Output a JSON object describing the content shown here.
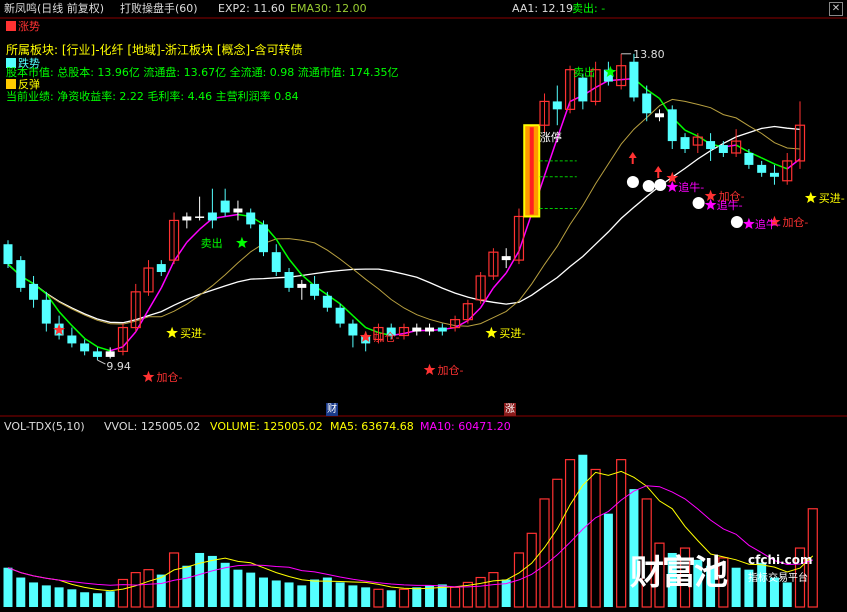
{
  "header": {
    "stock": "新凤鸣(日线 前复权)",
    "formula": "打败操盘手(60)",
    "exp2": "EXP2: 11.60",
    "ema30": "EMA30: 12.00",
    "aa1": "AA1: 12.19",
    "sell": "卖出: -",
    "close_icon": "close-icon"
  },
  "legend": {
    "zhangshi": "涨势",
    "ruoshi": "跌势",
    "fantan": "反弹"
  },
  "info": {
    "line1": "所属板块: [行业]-化纤 [地域]-浙江板块 [概念]-含可转债",
    "line2": "股本市值: 总股本: 13.96亿 流通盘: 13.67亿 全流通: 0.98 流通市值: 174.35亿",
    "line3": "当前业绩: 净资收益率: 2.22 毛利率: 4.46 主营利润率 0.84"
  },
  "annotations": {
    "high": "13.80",
    "low": "9.94",
    "zhangting": "涨停",
    "maichu_star": "卖出",
    "maichu_top": "卖出",
    "buy1": "买进-",
    "buy2": "买进-",
    "buy3": "买进-",
    "add1": "加仓-",
    "add2": "加仓-",
    "add3": "加仓-",
    "add4": "加仓-",
    "add5": "加仓-",
    "add6": "加仓-",
    "chase1": "追牛-",
    "chase2": "追牛-",
    "chase3": "追牛-"
  },
  "axis_marks": {
    "cai": "财",
    "zhang": "涨"
  },
  "volume_header": {
    "indicator": "VOL-TDX(5,10)",
    "vvol": "VVOL: 125005.02",
    "volume": "VOLUME: 125005.02",
    "ma5": "MA5: 63674.68",
    "ma10": "MA10: 60471.20"
  },
  "brand": {
    "name": "财富池",
    "url": "cfchi.com",
    "slogan": "指标交易平台"
  },
  "colors": {
    "up": "#ff3232",
    "down": "#54ffff",
    "yellow": "#ffff00",
    "green": "#00ff00",
    "magenta": "#ff00ff",
    "orange": "#ff9900"
  },
  "chart_data": {
    "type": "candlestick",
    "ylim": [
      9.5,
      14.1
    ],
    "candles": [
      {
        "o": 11.4,
        "c": 11.15,
        "h": 11.45,
        "l": 11.1,
        "c_": "down"
      },
      {
        "o": 11.2,
        "c": 10.85,
        "h": 11.25,
        "l": 10.8,
        "c_": "down"
      },
      {
        "o": 10.9,
        "c": 10.7,
        "h": 11.0,
        "l": 10.6,
        "c_": "down"
      },
      {
        "o": 10.7,
        "c": 10.4,
        "h": 10.8,
        "l": 10.3,
        "c_": "down"
      },
      {
        "o": 10.4,
        "c": 10.25,
        "h": 10.5,
        "l": 10.2,
        "c_": "down"
      },
      {
        "o": 10.25,
        "c": 10.15,
        "h": 10.35,
        "l": 10.1,
        "c_": "down"
      },
      {
        "o": 10.15,
        "c": 10.05,
        "h": 10.2,
        "l": 10.0,
        "c_": "down"
      },
      {
        "o": 10.05,
        "c": 9.98,
        "h": 10.1,
        "l": 9.94,
        "c_": "down"
      },
      {
        "o": 9.98,
        "c": 10.05,
        "h": 10.1,
        "l": 9.96,
        "c_": "flat"
      },
      {
        "o": 10.05,
        "c": 10.35,
        "h": 10.4,
        "l": 10.0,
        "c_": "up"
      },
      {
        "o": 10.35,
        "c": 10.8,
        "h": 10.9,
        "l": 10.3,
        "c_": "up"
      },
      {
        "o": 10.8,
        "c": 11.1,
        "h": 11.2,
        "l": 10.75,
        "c_": "up"
      },
      {
        "o": 11.05,
        "c": 11.15,
        "h": 11.2,
        "l": 11.0,
        "c_": "down"
      },
      {
        "o": 11.2,
        "c": 11.7,
        "h": 11.8,
        "l": 11.15,
        "c_": "up"
      },
      {
        "o": 11.7,
        "c": 11.75,
        "h": 11.8,
        "l": 11.6,
        "c_": "flat"
      },
      {
        "o": 11.75,
        "c": 11.75,
        "h": 12.0,
        "l": 11.7,
        "c_": "flat"
      },
      {
        "o": 11.8,
        "c": 11.7,
        "h": 12.1,
        "l": 11.6,
        "c_": "down"
      },
      {
        "o": 11.95,
        "c": 11.8,
        "h": 12.1,
        "l": 11.75,
        "c_": "down"
      },
      {
        "o": 11.8,
        "c": 11.85,
        "h": 11.95,
        "l": 11.7,
        "c_": "flat"
      },
      {
        "o": 11.8,
        "c": 11.65,
        "h": 11.85,
        "l": 11.6,
        "c_": "down"
      },
      {
        "o": 11.65,
        "c": 11.3,
        "h": 11.7,
        "l": 11.25,
        "c_": "down"
      },
      {
        "o": 11.3,
        "c": 11.05,
        "h": 11.4,
        "l": 11.0,
        "c_": "down"
      },
      {
        "o": 11.05,
        "c": 10.85,
        "h": 11.1,
        "l": 10.8,
        "c_": "down"
      },
      {
        "o": 10.9,
        "c": 10.85,
        "h": 10.95,
        "l": 10.7,
        "c_": "flat"
      },
      {
        "o": 10.9,
        "c": 10.75,
        "h": 11.0,
        "l": 10.7,
        "c_": "down"
      },
      {
        "o": 10.75,
        "c": 10.6,
        "h": 10.8,
        "l": 10.55,
        "c_": "down"
      },
      {
        "o": 10.6,
        "c": 10.4,
        "h": 10.65,
        "l": 10.35,
        "c_": "down"
      },
      {
        "o": 10.4,
        "c": 10.25,
        "h": 10.45,
        "l": 10.1,
        "c_": "down"
      },
      {
        "o": 10.25,
        "c": 10.15,
        "h": 10.3,
        "l": 10.05,
        "c_": "down"
      },
      {
        "o": 10.2,
        "c": 10.35,
        "h": 10.4,
        "l": 10.15,
        "c_": "up"
      },
      {
        "o": 10.35,
        "c": 10.25,
        "h": 10.4,
        "l": 10.2,
        "c_": "down"
      },
      {
        "o": 10.25,
        "c": 10.35,
        "h": 10.4,
        "l": 10.2,
        "c_": "up"
      },
      {
        "o": 10.35,
        "c": 10.3,
        "h": 10.4,
        "l": 10.25,
        "c_": "flat"
      },
      {
        "o": 10.3,
        "c": 10.35,
        "h": 10.4,
        "l": 10.25,
        "c_": "flat"
      },
      {
        "o": 10.35,
        "c": 10.3,
        "h": 10.4,
        "l": 10.25,
        "c_": "down"
      },
      {
        "o": 10.35,
        "c": 10.45,
        "h": 10.5,
        "l": 10.3,
        "c_": "up"
      },
      {
        "o": 10.45,
        "c": 10.65,
        "h": 10.7,
        "l": 10.4,
        "c_": "up"
      },
      {
        "o": 10.7,
        "c": 11.0,
        "h": 11.05,
        "l": 10.65,
        "c_": "up"
      },
      {
        "o": 11.0,
        "c": 11.3,
        "h": 11.35,
        "l": 10.95,
        "c_": "up"
      },
      {
        "o": 11.25,
        "c": 11.2,
        "h": 11.35,
        "l": 11.1,
        "c_": "flat"
      },
      {
        "o": 11.2,
        "c": 11.75,
        "h": 11.85,
        "l": 11.15,
        "c_": "up"
      },
      {
        "o": 11.75,
        "c": 12.9,
        "h": 12.9,
        "l": 11.75,
        "c_": "limit"
      },
      {
        "o": 12.9,
        "c": 13.2,
        "h": 13.3,
        "l": 12.8,
        "c_": "up"
      },
      {
        "o": 13.2,
        "c": 13.1,
        "h": 13.4,
        "l": 12.9,
        "c_": "down"
      },
      {
        "o": 13.1,
        "c": 13.6,
        "h": 13.65,
        "l": 13.05,
        "c_": "up"
      },
      {
        "o": 13.5,
        "c": 13.2,
        "h": 13.55,
        "l": 13.1,
        "c_": "down"
      },
      {
        "o": 13.2,
        "c": 13.6,
        "h": 13.7,
        "l": 13.15,
        "c_": "up"
      },
      {
        "o": 13.6,
        "c": 13.45,
        "h": 13.7,
        "l": 13.4,
        "c_": "down"
      },
      {
        "o": 13.4,
        "c": 13.65,
        "h": 13.8,
        "l": 13.35,
        "c_": "up"
      },
      {
        "o": 13.7,
        "c": 13.25,
        "h": 13.8,
        "l": 13.2,
        "c_": "down"
      },
      {
        "o": 13.3,
        "c": 13.05,
        "h": 13.4,
        "l": 12.95,
        "c_": "down"
      },
      {
        "o": 13.05,
        "c": 13.0,
        "h": 13.1,
        "l": 12.95,
        "c_": "flat"
      },
      {
        "o": 13.1,
        "c": 12.7,
        "h": 13.15,
        "l": 12.6,
        "c_": "down"
      },
      {
        "o": 12.75,
        "c": 12.6,
        "h": 12.8,
        "l": 12.55,
        "c_": "down"
      },
      {
        "o": 12.65,
        "c": 12.75,
        "h": 12.8,
        "l": 12.55,
        "c_": "up"
      },
      {
        "o": 12.7,
        "c": 12.6,
        "h": 12.8,
        "l": 12.45,
        "c_": "down"
      },
      {
        "o": 12.65,
        "c": 12.55,
        "h": 12.7,
        "l": 12.5,
        "c_": "down"
      },
      {
        "o": 12.55,
        "c": 12.7,
        "h": 12.85,
        "l": 12.5,
        "c_": "up"
      },
      {
        "o": 12.55,
        "c": 12.4,
        "h": 12.6,
        "l": 12.35,
        "c_": "down"
      },
      {
        "o": 12.4,
        "c": 12.3,
        "h": 12.45,
        "l": 12.25,
        "c_": "down"
      },
      {
        "o": 12.3,
        "c": 12.25,
        "h": 12.4,
        "l": 12.15,
        "c_": "down"
      },
      {
        "o": 12.2,
        "c": 12.45,
        "h": 12.55,
        "l": 12.15,
        "c_": "up"
      },
      {
        "o": 12.45,
        "c": 12.9,
        "h": 13.2,
        "l": 12.35,
        "c_": "up"
      }
    ],
    "volumes": [
      {
        "v": 40,
        "c": "down"
      },
      {
        "v": 30,
        "c": "down"
      },
      {
        "v": 25,
        "c": "down"
      },
      {
        "v": 22,
        "c": "down"
      },
      {
        "v": 20,
        "c": "down"
      },
      {
        "v": 18,
        "c": "down"
      },
      {
        "v": 15,
        "c": "down"
      },
      {
        "v": 14,
        "c": "down"
      },
      {
        "v": 16,
        "c": "down"
      },
      {
        "v": 28,
        "c": "up"
      },
      {
        "v": 35,
        "c": "up"
      },
      {
        "v": 38,
        "c": "up"
      },
      {
        "v": 33,
        "c": "down"
      },
      {
        "v": 55,
        "c": "up"
      },
      {
        "v": 42,
        "c": "down"
      },
      {
        "v": 55,
        "c": "down"
      },
      {
        "v": 52,
        "c": "down"
      },
      {
        "v": 45,
        "c": "down"
      },
      {
        "v": 38,
        "c": "down"
      },
      {
        "v": 35,
        "c": "down"
      },
      {
        "v": 30,
        "c": "down"
      },
      {
        "v": 27,
        "c": "down"
      },
      {
        "v": 25,
        "c": "down"
      },
      {
        "v": 22,
        "c": "down"
      },
      {
        "v": 28,
        "c": "down"
      },
      {
        "v": 30,
        "c": "down"
      },
      {
        "v": 25,
        "c": "down"
      },
      {
        "v": 22,
        "c": "down"
      },
      {
        "v": 20,
        "c": "down"
      },
      {
        "v": 18,
        "c": "up"
      },
      {
        "v": 17,
        "c": "down"
      },
      {
        "v": 18,
        "c": "up"
      },
      {
        "v": 20,
        "c": "down"
      },
      {
        "v": 22,
        "c": "down"
      },
      {
        "v": 23,
        "c": "down"
      },
      {
        "v": 20,
        "c": "up"
      },
      {
        "v": 25,
        "c": "up"
      },
      {
        "v": 30,
        "c": "up"
      },
      {
        "v": 35,
        "c": "up"
      },
      {
        "v": 28,
        "c": "down"
      },
      {
        "v": 55,
        "c": "up"
      },
      {
        "v": 75,
        "c": "up"
      },
      {
        "v": 110,
        "c": "up"
      },
      {
        "v": 130,
        "c": "up"
      },
      {
        "v": 150,
        "c": "up"
      },
      {
        "v": 155,
        "c": "down"
      },
      {
        "v": 140,
        "c": "up"
      },
      {
        "v": 95,
        "c": "down"
      },
      {
        "v": 150,
        "c": "up"
      },
      {
        "v": 120,
        "c": "down"
      },
      {
        "v": 110,
        "c": "up"
      },
      {
        "v": 65,
        "c": "up"
      },
      {
        "v": 55,
        "c": "down"
      },
      {
        "v": 60,
        "c": "up"
      },
      {
        "v": 48,
        "c": "down"
      },
      {
        "v": 42,
        "c": "down"
      },
      {
        "v": 50,
        "c": "up"
      },
      {
        "v": 40,
        "c": "down"
      },
      {
        "v": 38,
        "c": "down"
      },
      {
        "v": 45,
        "c": "down"
      },
      {
        "v": 30,
        "c": "down"
      },
      {
        "v": 25,
        "c": "down"
      },
      {
        "v": 60,
        "c": "up"
      },
      {
        "v": 100,
        "c": "up"
      }
    ]
  }
}
